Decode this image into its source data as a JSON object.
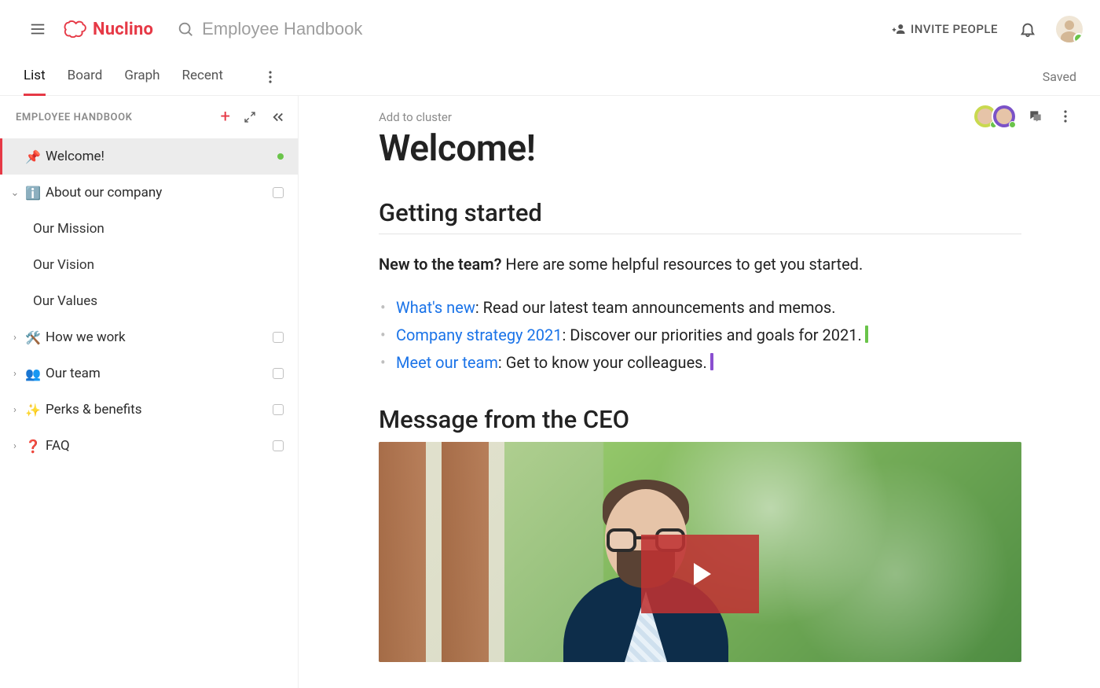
{
  "app": {
    "name": "Nuclino"
  },
  "topbar": {
    "search_placeholder": "Employee Handbook",
    "invite_label": "INVITE PEOPLE"
  },
  "tabs": {
    "items": [
      "List",
      "Board",
      "Graph",
      "Recent"
    ],
    "active_index": 0,
    "saved_label": "Saved"
  },
  "sidebar": {
    "title": "EMPLOYEE HANDBOOK",
    "tree": [
      {
        "emoji": "📌",
        "label": "Welcome!",
        "active": true,
        "live": true
      },
      {
        "chevron": "down",
        "emoji": "ℹ️",
        "label": "About our company",
        "badge": true,
        "children": [
          {
            "label": "Our Mission"
          },
          {
            "label": "Our Vision"
          },
          {
            "label": "Our Values"
          }
        ]
      },
      {
        "chevron": "right",
        "emoji": "🛠️",
        "label": "How we work",
        "badge": true
      },
      {
        "chevron": "right",
        "emoji": "👥",
        "label": "Our team",
        "badge": true
      },
      {
        "chevron": "right",
        "emoji": "✨",
        "label": "Perks & benefits",
        "badge": true
      },
      {
        "chevron": "right",
        "emoji": "❓",
        "label": "FAQ",
        "badge": true
      }
    ]
  },
  "document": {
    "add_cluster_label": "Add to cluster",
    "title": "Welcome!",
    "section_started": "Getting started",
    "intro_strong": "New to the team?",
    "intro_rest": " Here are some helpful resources to get you started.",
    "bullets": [
      {
        "link": "What's new",
        "rest": ": Read our latest team announcements and memos."
      },
      {
        "link": "Company strategy 2021",
        "rest": ": Discover our priorities and goals for 2021.",
        "cursor": "green"
      },
      {
        "link": "Meet our team",
        "rest": ": Get to know your colleagues.",
        "cursor": "purple"
      }
    ],
    "section_ceo": "Message from the CEO"
  }
}
